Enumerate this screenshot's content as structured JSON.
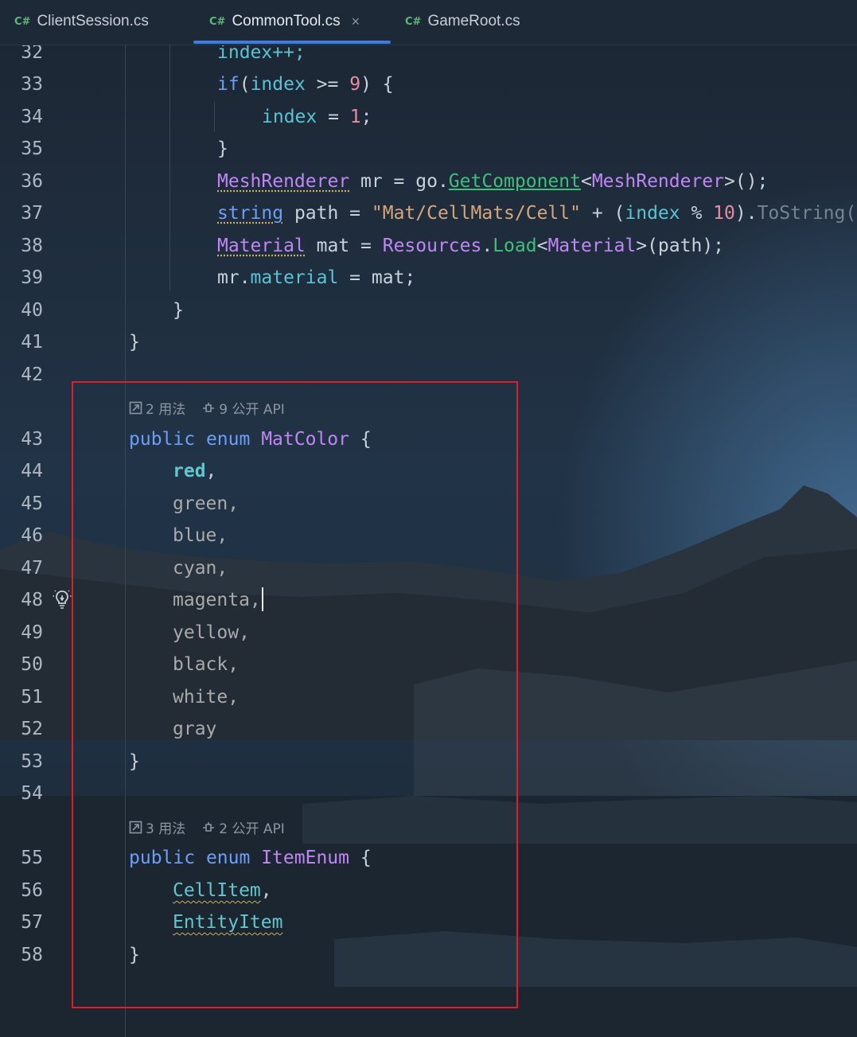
{
  "tabs": [
    {
      "icon": "C#",
      "label": "ClientSession.cs",
      "active": false
    },
    {
      "icon": "C#",
      "label": "CommonTool.cs",
      "active": true,
      "close": "×"
    },
    {
      "icon": "C#",
      "label": "GameRoot.cs",
      "active": false
    }
  ],
  "line_numbers": [
    "32",
    "33",
    "34",
    "35",
    "36",
    "37",
    "38",
    "39",
    "40",
    "41",
    "42",
    "43",
    "44",
    "45",
    "46",
    "47",
    "48",
    "49",
    "50",
    "51",
    "52",
    "53",
    "54",
    "55",
    "56",
    "57",
    "58"
  ],
  "code": {
    "l32": {
      "a": "index++;"
    },
    "l33": {
      "a": "if",
      "b": "(",
      "c": "index",
      "d": " >= ",
      "e": "9",
      "f": ") {"
    },
    "l34": {
      "a": "index",
      "b": " = ",
      "c": "1",
      "d": ";"
    },
    "l35": {
      "a": "}"
    },
    "l36": {
      "a": "MeshRenderer",
      "b": " mr = go.",
      "c": "GetComponent",
      "d": "<",
      "e": "MeshRenderer",
      "f": ">();"
    },
    "l37": {
      "a": "string",
      "b": " path = ",
      "c": "\"Mat/CellMats/Cell\"",
      "d": " + (",
      "e": "index",
      "f": " % ",
      "g": "10",
      "h": ").",
      "i": "ToString("
    },
    "l38": {
      "a": "Material",
      "b": " mat = ",
      "c": "Resources",
      "d": ".",
      "e": "Load",
      "f": "<",
      "g": "Material",
      "h": ">(path);"
    },
    "l39": {
      "a": "mr.",
      "b": "material",
      "c": " = mat;"
    },
    "l40": {
      "a": "}"
    },
    "l41": {
      "a": "}"
    },
    "l43": {
      "a": "public",
      "b": " ",
      "c": "enum",
      "d": " ",
      "e": "MatColor",
      "f": " {"
    },
    "l44": {
      "a": "red",
      "b": ","
    },
    "l45": {
      "a": "green,"
    },
    "l46": {
      "a": "blue,"
    },
    "l47": {
      "a": "cyan,"
    },
    "l48": {
      "a": "magenta,"
    },
    "l49": {
      "a": "yellow,"
    },
    "l50": {
      "a": "black,"
    },
    "l51": {
      "a": "white,"
    },
    "l52": {
      "a": "gray"
    },
    "l53": {
      "a": "}"
    },
    "l55": {
      "a": "public",
      "b": " ",
      "c": "enum",
      "d": " ",
      "e": "ItemEnum",
      "f": " {"
    },
    "l56": {
      "a": "CellItem",
      "b": ","
    },
    "l57": {
      "a": "EntityItem"
    },
    "l58": {
      "a": "}"
    }
  },
  "hints": {
    "matcolor": {
      "usages": "2 用法",
      "api": "9 公开 API"
    },
    "itemenum": {
      "usages": "3 用法",
      "api": "2 公开 API"
    }
  },
  "icons": {
    "usages": "open-usages-icon",
    "api": "public-api-icon",
    "bulb": "lightbulb-icon"
  },
  "colors": {
    "keyword": "#6c9ef8",
    "type": "#c086f5",
    "number": "#e88ca2",
    "string": "#d6a67a",
    "method": "#3fbf7c",
    "field": "#5ac3d3",
    "annotation_box": "#e11d2c",
    "tab_underline": "#3b7de2"
  }
}
